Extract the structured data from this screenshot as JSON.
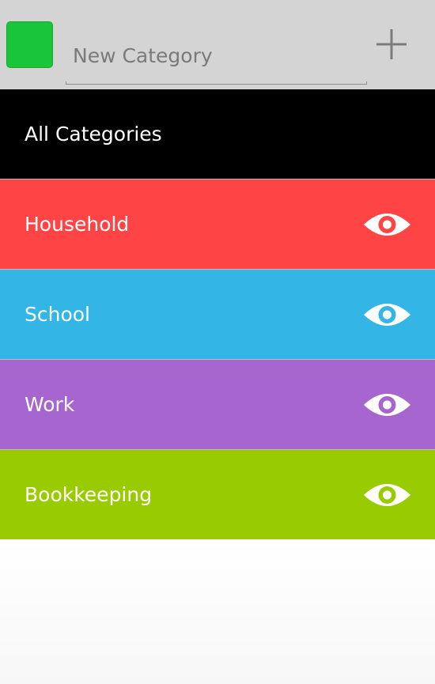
{
  "header": {
    "swatch_color": "#19c53a",
    "input": {
      "value": "",
      "placeholder": "New Category"
    },
    "add_icon": "plus-icon"
  },
  "categories": [
    {
      "label": "All Categories",
      "color": "#000000",
      "show_toggle": false
    },
    {
      "label": "Household",
      "color": "#fe4444",
      "show_toggle": true,
      "toggle_icon": "eye-icon"
    },
    {
      "label": "School",
      "color": "#33b5e5",
      "show_toggle": true,
      "toggle_icon": "eye-icon"
    },
    {
      "label": "Work",
      "color": "#a665cf",
      "show_toggle": true,
      "toggle_icon": "eye-icon"
    },
    {
      "label": "Bookkeeping",
      "color": "#99cc00",
      "show_toggle": true,
      "toggle_icon": "eye-icon"
    }
  ]
}
